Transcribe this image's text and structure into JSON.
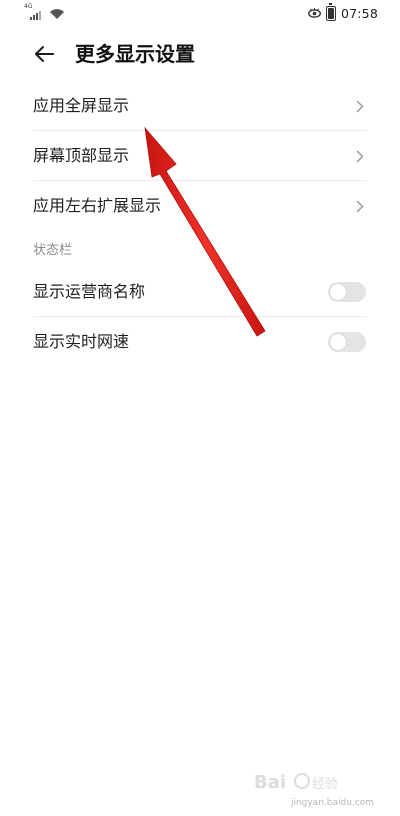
{
  "status_bar": {
    "network": "4G",
    "time": "07:58",
    "battery_level": 0.8,
    "icons": [
      "signal-icon",
      "wifi-icon",
      "eye-comfort-icon",
      "battery-icon"
    ]
  },
  "header": {
    "back_icon": "back-arrow-icon",
    "title": "更多显示设置"
  },
  "list": {
    "items": [
      {
        "label": "应用全屏显示",
        "control": "chevron"
      },
      {
        "label": "屏幕顶部显示",
        "control": "chevron"
      },
      {
        "label": "应用左右扩展显示",
        "control": "chevron"
      }
    ]
  },
  "status_bar_section": {
    "title": "状态栏",
    "items": [
      {
        "label": "显示运营商名称",
        "control": "toggle",
        "on": false
      },
      {
        "label": "显示实时网速",
        "control": "toggle",
        "on": false
      }
    ]
  },
  "annotation": {
    "type": "arrow",
    "color": "#e8231f"
  },
  "watermark": {
    "logo": "Baidu经验",
    "url": "jingyan.baidu.com"
  }
}
